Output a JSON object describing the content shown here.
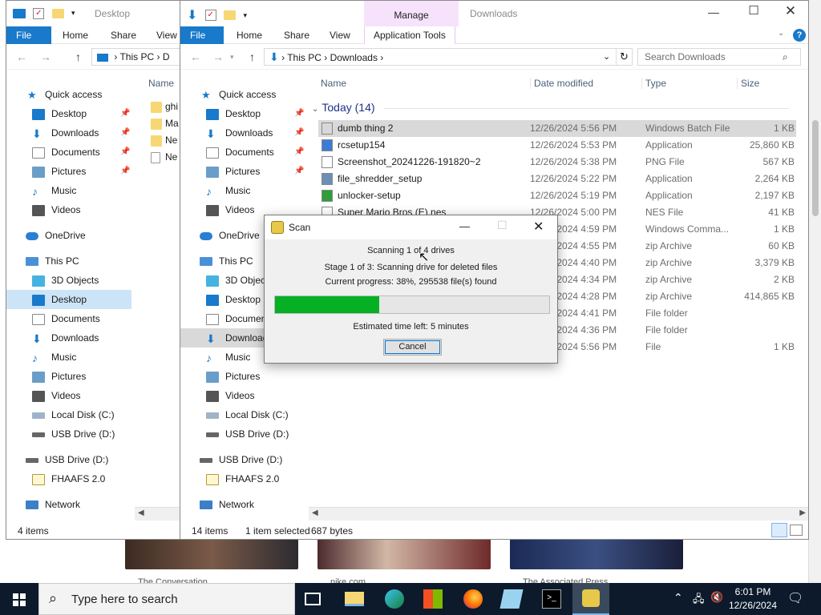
{
  "left_window": {
    "title": "Desktop",
    "tabs": [
      "File",
      "Home",
      "Share",
      "View"
    ],
    "address": [
      "This PC",
      "D"
    ],
    "column_name": "Name",
    "files": [
      "ghi",
      "Ma",
      "Ne",
      "Ne"
    ],
    "nav": {
      "quick_access": "Quick access",
      "quick_items": [
        "Desktop",
        "Downloads",
        "Documents",
        "Pictures",
        "Music",
        "Videos"
      ],
      "onedrive": "OneDrive",
      "this_pc": "This PC",
      "pc_items": [
        "3D Objects",
        "Desktop",
        "Documents",
        "Downloads",
        "Music",
        "Pictures",
        "Videos",
        "Local Disk (C:)",
        "USB Drive (D:)"
      ],
      "usb": "USB Drive (D:)",
      "fhaafs": "FHAAFS 2.0",
      "network": "Network"
    },
    "status": "4 items"
  },
  "right_window": {
    "title": "Downloads",
    "manage": "Manage",
    "tabs": [
      "File",
      "Home",
      "Share",
      "View",
      "Application Tools"
    ],
    "address": [
      "This PC",
      "Downloads"
    ],
    "search_placeholder": "Search Downloads",
    "columns": [
      "Name",
      "Date modified",
      "Type",
      "Size"
    ],
    "group": "Today (14)",
    "rows": [
      {
        "name": "dumb thing 2",
        "date": "12/26/2024 5:56 PM",
        "type": "Windows Batch File",
        "size": "1 KB"
      },
      {
        "name": "rcsetup154",
        "date": "12/26/2024 5:53 PM",
        "type": "Application",
        "size": "25,860 KB"
      },
      {
        "name": "Screenshot_20241226-191820~2",
        "date": "12/26/2024 5:38 PM",
        "type": "PNG File",
        "size": "567 KB"
      },
      {
        "name": "file_shredder_setup",
        "date": "12/26/2024 5:22 PM",
        "type": "Application",
        "size": "2,264 KB"
      },
      {
        "name": "unlocker-setup",
        "date": "12/26/2024 5:19 PM",
        "type": "Application",
        "size": "2,197 KB"
      },
      {
        "name": "Super Mario Bros (E).nes",
        "date": "12/26/2024 5:00 PM",
        "type": "NES File",
        "size": "41 KB"
      },
      {
        "name": "",
        "date": "12/26/2024 4:59 PM",
        "type": "Windows Comma...",
        "size": "1 KB"
      },
      {
        "name": "",
        "date": "12/26/2024 4:55 PM",
        "type": "zip Archive",
        "size": "60 KB"
      },
      {
        "name": "",
        "date": "12/26/2024 4:40 PM",
        "type": "zip Archive",
        "size": "3,379 KB"
      },
      {
        "name": "",
        "date": "12/26/2024 4:34 PM",
        "type": "zip Archive",
        "size": "2 KB"
      },
      {
        "name": "",
        "date": "12/26/2024 4:28 PM",
        "type": "zip Archive",
        "size": "414,865 KB"
      },
      {
        "name": "",
        "date": "12/26/2024 4:41 PM",
        "type": "File folder",
        "size": ""
      },
      {
        "name": "",
        "date": "12/26/2024 4:36 PM",
        "type": "File folder",
        "size": ""
      },
      {
        "name": "",
        "date": "12/26/2024 5:56 PM",
        "type": "File",
        "size": "1 KB"
      }
    ],
    "nav": {
      "quick_access": "Quick access",
      "quick_items": [
        "Desktop",
        "Downloads",
        "Documents",
        "Pictures",
        "Music",
        "Videos"
      ],
      "onedrive": "OneDrive",
      "this_pc": "This PC",
      "pc_items": [
        "3D Object",
        "Desktop",
        "Documen",
        "Download",
        "Music",
        "Pictures",
        "Videos",
        "Local Disk (C:)",
        "USB Drive (D:)"
      ],
      "usb": "USB Drive (D:)",
      "fhaafs": "FHAAFS 2.0",
      "network": "Network"
    },
    "status": {
      "items": "14 items",
      "selected": "1 item selected",
      "size": "687 bytes"
    }
  },
  "dialog": {
    "title": "Scan",
    "line1": "Scanning 1 of 4 drives",
    "line2": "Stage 1 of 3: Scanning drive for deleted files",
    "line3": "Current progress: 38%, 295538 file(s) found",
    "progress": 0.38,
    "eta": "Estimated time left: 5 minutes",
    "cancel": "Cancel"
  },
  "background": {
    "captions": [
      "The Conversation",
      "nike.com",
      "The Associated Press"
    ]
  },
  "taskbar": {
    "search_placeholder": "Type here to search",
    "time": "6:01 PM",
    "date": "12/26/2024"
  },
  "colors": {
    "accent": "#1979ca",
    "progress": "#06b025",
    "manage": "#f6e3fb",
    "taskbar": "#0c1a2b"
  }
}
